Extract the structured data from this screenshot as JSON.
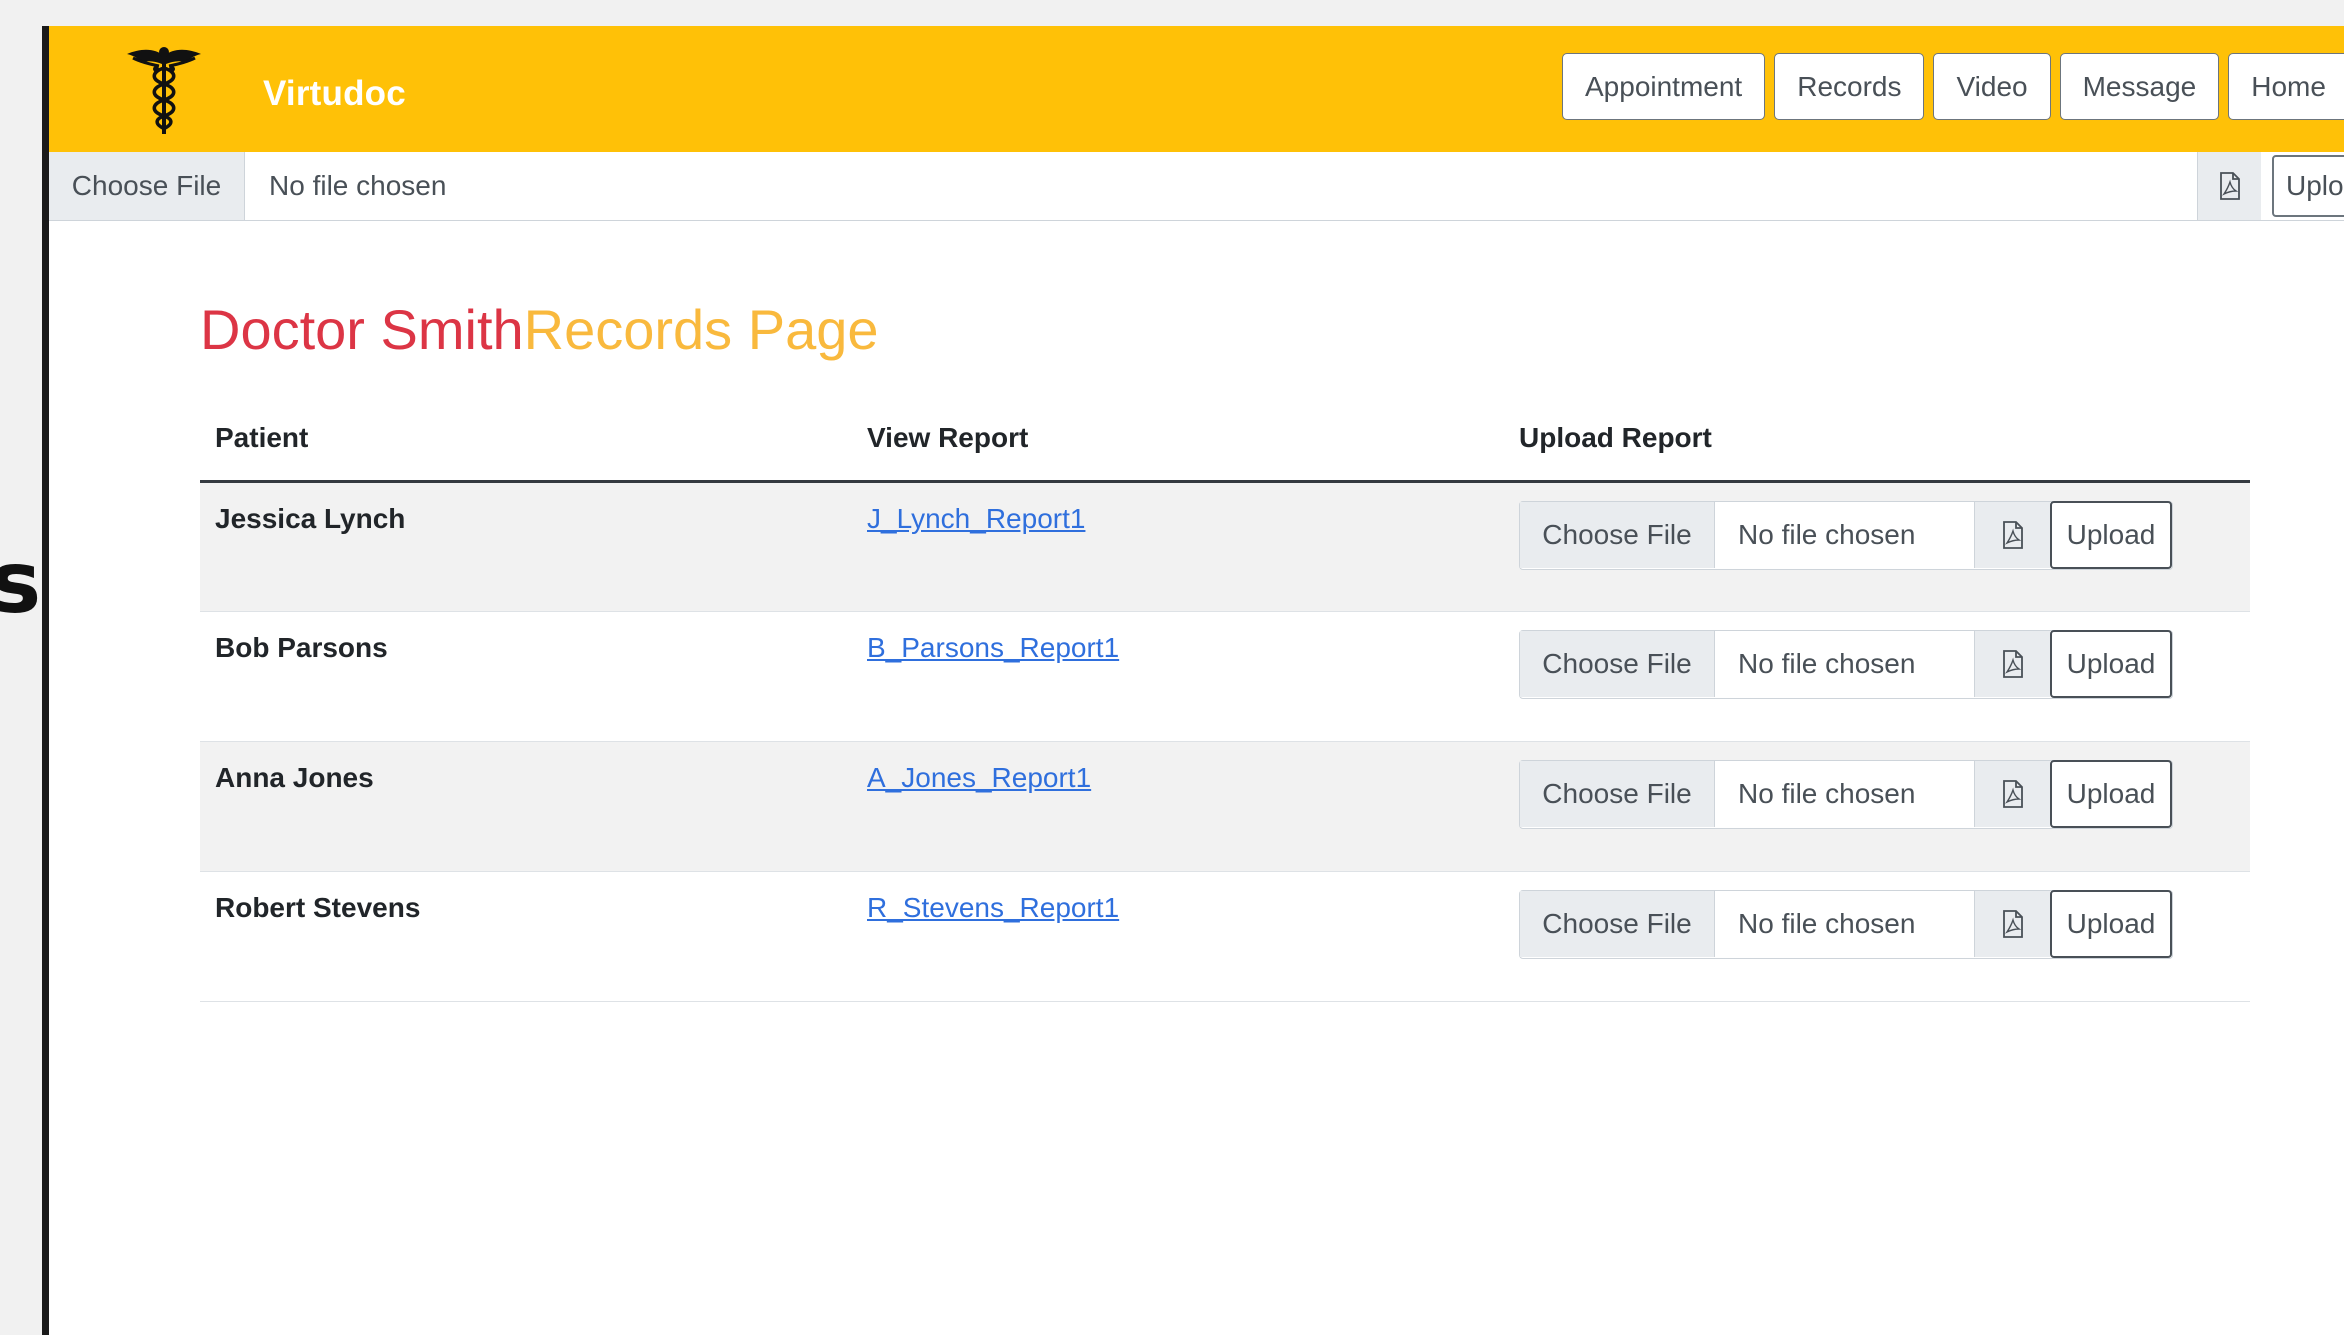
{
  "navbar": {
    "brand": "Virtudoc",
    "buttons": [
      {
        "label": "Appointment"
      },
      {
        "label": "Records"
      },
      {
        "label": "Video"
      },
      {
        "label": "Message"
      },
      {
        "label": "Home"
      }
    ],
    "colors": {
      "background": "#ffc107",
      "brand_text": "#ffffff"
    }
  },
  "top_file_input": {
    "choose_label": "Choose File",
    "status": "No file chosen",
    "upload_label": "Uplo"
  },
  "left_strip": {
    "partial_glyph": "s"
  },
  "page": {
    "title_doctor": "Doctor Smith",
    "title_rest": "Records Page",
    "colors": {
      "doctor": "#dc3545",
      "rest": "#f9b93d"
    }
  },
  "table": {
    "columns": [
      "Patient",
      "View Report",
      "Upload Report"
    ],
    "rows": [
      {
        "patient": "Jessica Lynch",
        "report": "J_Lynch_Report1",
        "choose_label": "Choose File",
        "status": "No file chosen",
        "upload_label": "Upload"
      },
      {
        "patient": "Bob Parsons",
        "report": "B_Parsons_Report1",
        "choose_label": "Choose File",
        "status": "No file chosen",
        "upload_label": "Upload"
      },
      {
        "patient": "Anna Jones",
        "report": "A_Jones_Report1",
        "choose_label": "Choose File",
        "status": "No file chosen",
        "upload_label": "Upload"
      },
      {
        "patient": "Robert Stevens",
        "report": "R_Stevens_Report1",
        "choose_label": "Choose File",
        "status": "No file chosen",
        "upload_label": "Upload"
      }
    ]
  },
  "icons": {
    "logo": "caduceus-icon",
    "file_type": "pdf-file-icon"
  }
}
